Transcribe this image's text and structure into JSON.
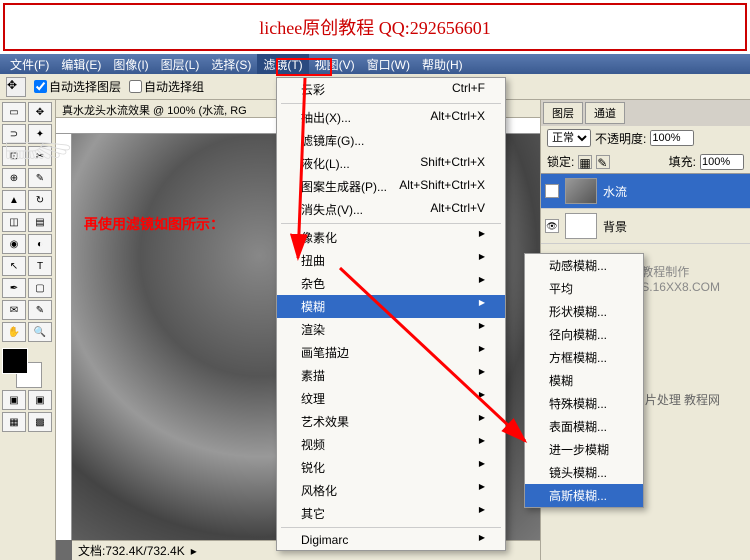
{
  "banner": "lichee原创教程 QQ:292656601",
  "menubar": {
    "items": [
      "文件(F)",
      "编辑(E)",
      "图像(I)",
      "图层(L)",
      "选择(S)",
      "滤镜(T)",
      "视图(V)",
      "窗口(W)",
      "帮助(H)"
    ]
  },
  "toolbar": {
    "autoSelectLayer": "自动选择图层",
    "autoSelectGroup": "自动选择组"
  },
  "docTitle": "真水龙头水流效果 @ 100% (水流, RG",
  "canvasText": "再使用滤镜如图所示：",
  "statusbar": "文档:732.4K/732.4K",
  "filterMenu": {
    "top": {
      "label": "云彩",
      "shortcut": "Ctrl+F"
    },
    "items": [
      {
        "label": "抽出(X)...",
        "shortcut": "Alt+Ctrl+X"
      },
      {
        "label": "滤镜库(G)...",
        "shortcut": ""
      },
      {
        "label": "液化(L)...",
        "shortcut": "Shift+Ctrl+X"
      },
      {
        "label": "图案生成器(P)...",
        "shortcut": "Alt+Shift+Ctrl+X"
      },
      {
        "label": "消失点(V)...",
        "shortcut": "Alt+Ctrl+V"
      }
    ],
    "groups": [
      "像素化",
      "扭曲",
      "杂色",
      "模糊",
      "渲染",
      "画笔描边",
      "素描",
      "纹理",
      "艺术效果",
      "视频",
      "锐化",
      "风格化",
      "其它"
    ],
    "digimarc": "Digimarc"
  },
  "blurMenu": {
    "items": [
      "动感模糊...",
      "平均",
      "形状模糊...",
      "径向模糊...",
      "方框模糊...",
      "模糊",
      "特殊模糊...",
      "表面模糊...",
      "进一步模糊",
      "镜头模糊...",
      "高斯模糊..."
    ]
  },
  "panels": {
    "tabs": [
      "图层",
      "通道"
    ],
    "blendMode": "正常",
    "opacityLabel": "不透明度:",
    "opacity": "100%",
    "lockLabel": "锁定:",
    "fillLabel": "填充:",
    "fill": "100%",
    "layers": [
      {
        "name": "水流"
      },
      {
        "name": "背景"
      }
    ]
  },
  "watermark": "PS教程制作",
  "watermark_url": "BBS.16XX8.COM",
  "watermark2a": "图片处理",
  "watermark2b": "教程网"
}
